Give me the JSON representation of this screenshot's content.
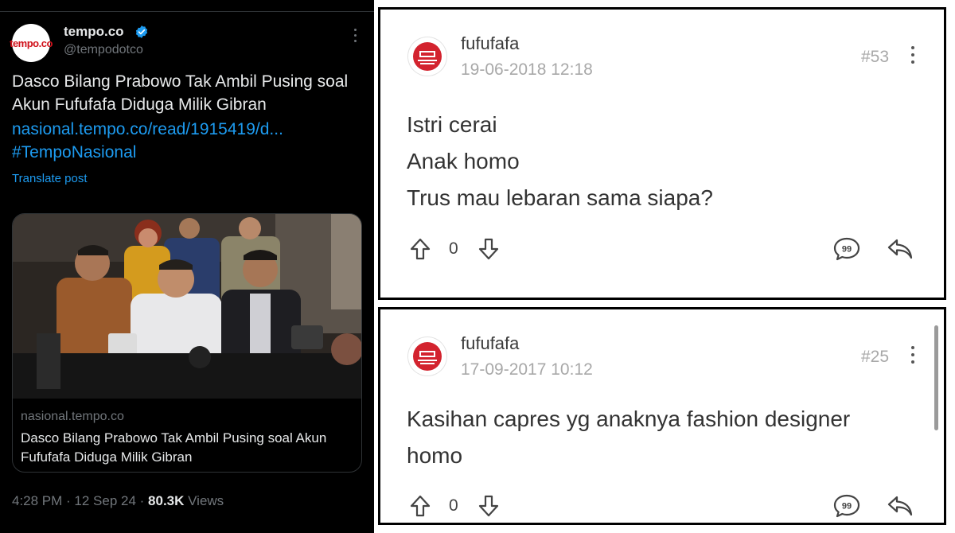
{
  "tweet": {
    "avatar_text": "tempo.co",
    "display_name": "tempo.co",
    "handle": "@tempodotco",
    "text": "Dasco Bilang Prabowo Tak Ambil Pusing soal Akun Fufufafa Diduga Milik Gibran",
    "link": "nasional.tempo.co/read/1915419/d...",
    "hashtag": "#TempoNasional",
    "translate_label": "Translate post",
    "card": {
      "domain": "nasional.tempo.co",
      "title": "Dasco Bilang Prabowo Tak Ambil Pusing soal Akun Fufufafa Diduga Milik Gibran"
    },
    "time": "4:28 PM · 12 Sep 24 · ",
    "views_count": "80.3K",
    "views_label": " Views",
    "colors": {
      "background": "#000000",
      "link": "#1d9bf0",
      "verified": "#1d9bf0",
      "brand": "#d0121b"
    }
  },
  "comments": [
    {
      "username": "fufufafa",
      "date": "19-06-2018 12:18",
      "number": "#53",
      "lines": [
        "Istri cerai",
        "Anak homo",
        "Trus mau lebaran sama siapa?"
      ],
      "votes": "0"
    },
    {
      "username": "fufufafa",
      "date": "17-09-2017 10:12",
      "number": "#25",
      "lines": [
        "Kasihan capres yg anaknya fashion designer",
        "homo"
      ],
      "votes": "0"
    }
  ],
  "icons": {
    "verified": "verified-badge-icon",
    "more": "more-dots-icon",
    "upvote": "arrow-up-icon",
    "downvote": "arrow-down-icon",
    "quote": "quote-icon",
    "reply": "reply-icon"
  }
}
